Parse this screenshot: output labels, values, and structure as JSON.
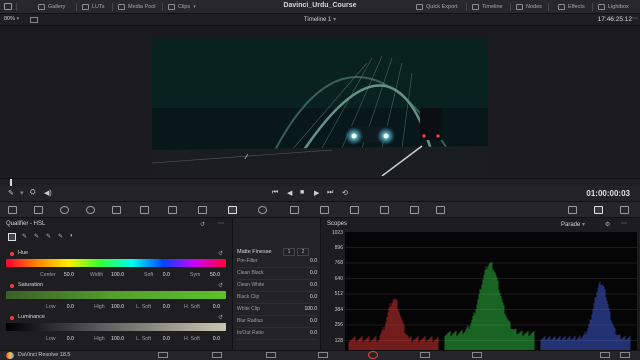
{
  "topbar": {
    "items": [
      {
        "label": "Gallery",
        "icon": "gallery-icon"
      },
      {
        "label": "LUTs",
        "icon": "luts-icon"
      },
      {
        "label": "Media Pool",
        "icon": "media-pool-icon"
      },
      {
        "label": "Clips",
        "icon": "clips-icon"
      }
    ],
    "project_title": "Davinci_Urdu_Course",
    "right_items": [
      {
        "label": "Quick Export",
        "icon": "export-icon"
      },
      {
        "label": "Timeline",
        "icon": "timeline-icon"
      },
      {
        "label": "Nodes",
        "icon": "nodes-icon"
      },
      {
        "label": "Effects",
        "icon": "effects-icon"
      },
      {
        "label": "Lightbox",
        "icon": "lightbox-icon"
      }
    ]
  },
  "subbar": {
    "zoom": "80%",
    "timeline_name": "Timeline 1",
    "timecode": "17:46:25:12"
  },
  "transport": {
    "timecode": "01:00:00:03"
  },
  "qualifier": {
    "title": "Qualifier - HSL",
    "hue": {
      "label": "Hue",
      "center_label": "Center",
      "center": "50.0",
      "width_label": "Width",
      "width": "100.0",
      "soft_label": "Soft",
      "soft": "0.0",
      "sym_label": "Sym",
      "sym": "50.0"
    },
    "saturation": {
      "label": "Saturation",
      "low_label": "Low",
      "low": "0.0",
      "high_label": "High",
      "high": "100.0",
      "lsoft_label": "L. Soft",
      "lsoft": "0.0",
      "hsoft_label": "H. Soft",
      "hsoft": "0.0"
    },
    "luminance": {
      "label": "Luminance",
      "low_label": "Low",
      "low": "0.0",
      "high_label": "High",
      "high": "100.0",
      "lsoft_label": "L. Soft",
      "lsoft": "0.0",
      "hsoft_label": "H. Soft",
      "hsoft": "0.0"
    }
  },
  "matte": {
    "title": "Matte Finesse",
    "tabs": [
      "1",
      "2"
    ],
    "rows": [
      {
        "label": "Pre-Filter",
        "value": "0.0"
      },
      {
        "label": "Clean Black",
        "value": "0.0"
      },
      {
        "label": "Clean White",
        "value": "0.0"
      },
      {
        "label": "Black Clip",
        "value": "0.0"
      },
      {
        "label": "White Clip",
        "value": "100.0"
      },
      {
        "label": "Blur Radius",
        "value": "0.0"
      },
      {
        "label": "In/Out Ratio",
        "value": "0.0"
      }
    ]
  },
  "scopes": {
    "title": "Scopes",
    "mode": "Parade",
    "ticks": [
      "1023",
      "896",
      "768",
      "640",
      "512",
      "384",
      "256",
      "128",
      "0"
    ]
  },
  "bottombar": {
    "app_name": "DaVinci Resolve 18.5"
  },
  "colors": {
    "red": "#ff3b3b",
    "green": "#35e04a",
    "blue": "#4d6bff",
    "accent": "#e0483a"
  }
}
